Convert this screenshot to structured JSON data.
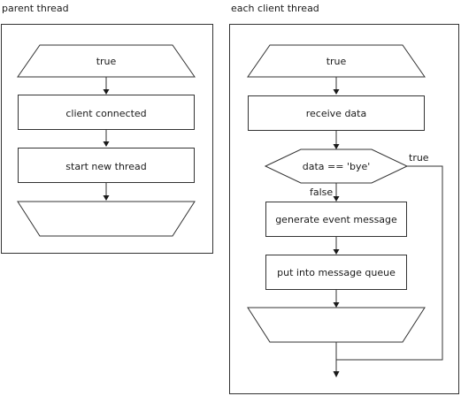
{
  "left_panel": {
    "caption": "parent thread",
    "loop_start": "true",
    "step1": "client connected",
    "step2": "start new thread"
  },
  "right_panel": {
    "caption": "each client thread",
    "loop_start": "true",
    "step1": "receive data",
    "decision": "data == 'bye'",
    "decision_true": "true",
    "decision_false": "false",
    "step2": "generate event message",
    "step3": "put into message queue"
  }
}
